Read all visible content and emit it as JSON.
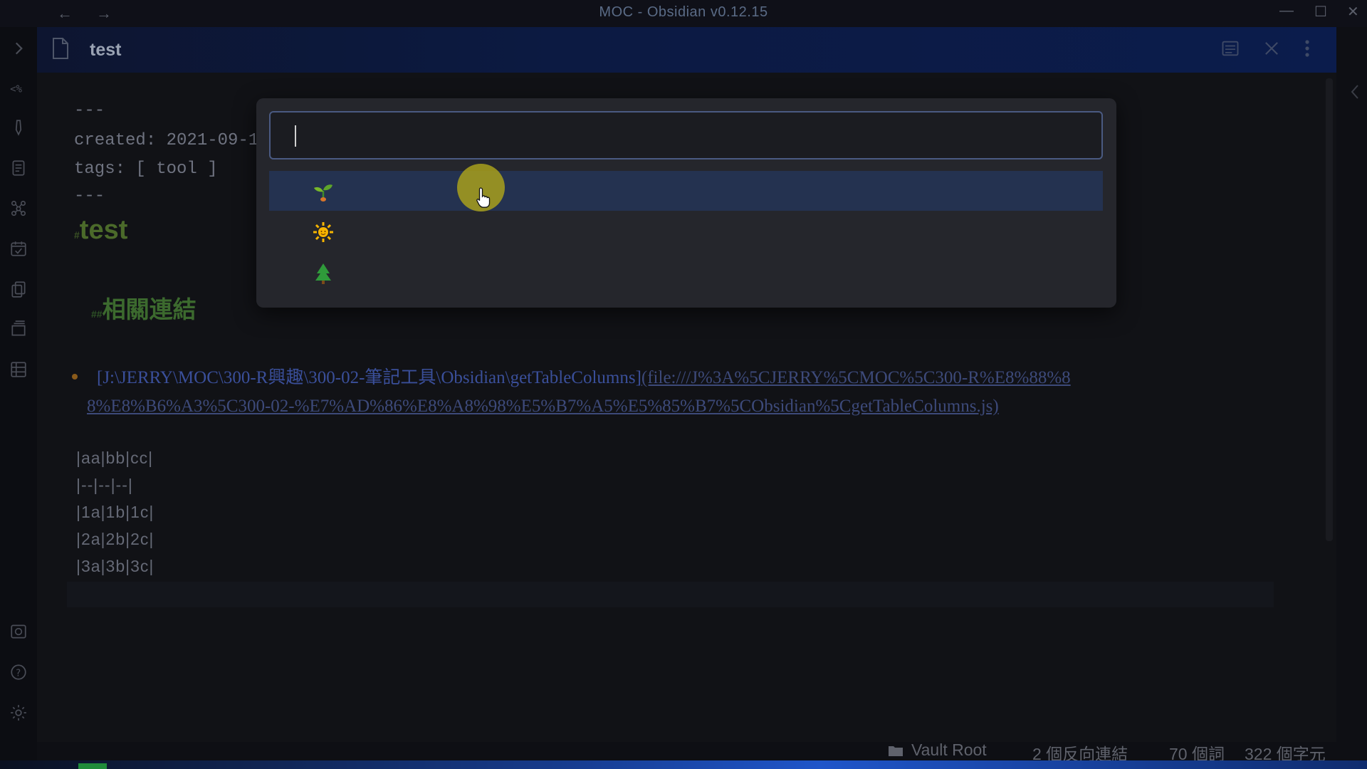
{
  "app": {
    "title": "MOC - Obsidian v0.12.15"
  },
  "titlebar": {
    "back": "←",
    "forward": "→",
    "minimize": "—",
    "maximize": "☐",
    "close": "✕"
  },
  "tab": {
    "title": "test"
  },
  "editor": {
    "frontmatter_open": "---",
    "created": "created: 2021-09-1",
    "tags": "tags: [ tool ]",
    "frontmatter_close": "---",
    "h1": "test",
    "h2": "相關連結",
    "link_path": "[J:\\JERRY\\MOC\\300-R興趣\\300-02-筆記工具\\Obsidian\\getTableColumns]",
    "link_url_line1": "(file:///J%3A%5CJERRY%5CMOC%5C300-R%E8%88%8",
    "link_url_line2": "8%E8%B6%A3%5C300-02-%E7%AD%86%E8%A8%98%E5%B7%A5%E5%85%B7%5CObsidian%5CgetTableColumns.js)",
    "table_lines": [
      "|aa|bb|cc|",
      "|--|--|--|",
      "|1a|1b|1c|",
      "|2a|2b|2c|",
      "|3a|3b|3c|"
    ]
  },
  "modal": {
    "input_value": "",
    "suggestions": [
      {
        "icon": "seedling-emoji",
        "selected": true
      },
      {
        "icon": "sun-emoji",
        "selected": false
      },
      {
        "icon": "evergreen-tree-emoji",
        "selected": false
      }
    ]
  },
  "statusbar": {
    "vault": "Vault Root",
    "backlinks": "2 個反向連結",
    "words": "70 個詞",
    "chars": "322 個字元"
  },
  "colors": {
    "accent": "#4a5a82",
    "selected_row": "#243250",
    "heading_green": "#4b6a2a",
    "link_blue": "#3a4f9a"
  }
}
